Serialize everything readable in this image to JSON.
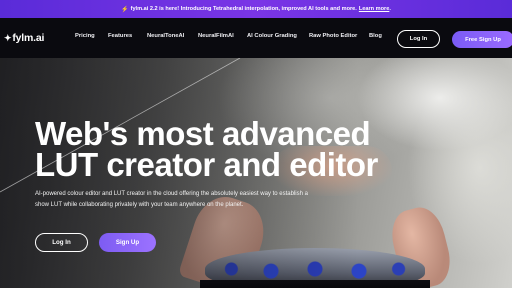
{
  "announcement": {
    "icon": "lightning-icon",
    "text": "fylm.ai 2.2 is here! Introducing Tetrahedral interpolation, improved AI tools and more.",
    "link": "Learn more",
    "suffix": "."
  },
  "nav": {
    "logo": "fylm.ai",
    "logo_icon": "fylm-logo-mark-icon",
    "items": [
      {
        "label": "Pricing"
      },
      {
        "label": "Features"
      },
      {
        "label": "NeuralToneAI"
      },
      {
        "label": "NeuralFilmAI"
      },
      {
        "label": "AI Colour Grading"
      },
      {
        "label": "Raw Photo Editor"
      },
      {
        "label": "Blog"
      }
    ],
    "login": "Log In",
    "signup": "Free Sign Up"
  },
  "hero": {
    "headline_line1": "Web's most advanced",
    "headline_line2": "LUT creator and editor",
    "subtext": "AI-powered colour editor and LUT creator in the cloud offering the absolutely easiest way to establish a show LUT while collaborating privately with your team anywhere on the planet.",
    "login": "Log In",
    "signup": "Sign Up"
  },
  "colors": {
    "announcement_bg": "#6a30e0",
    "accent": "#8a63f8",
    "nav_bg": "#0a0a0f"
  }
}
